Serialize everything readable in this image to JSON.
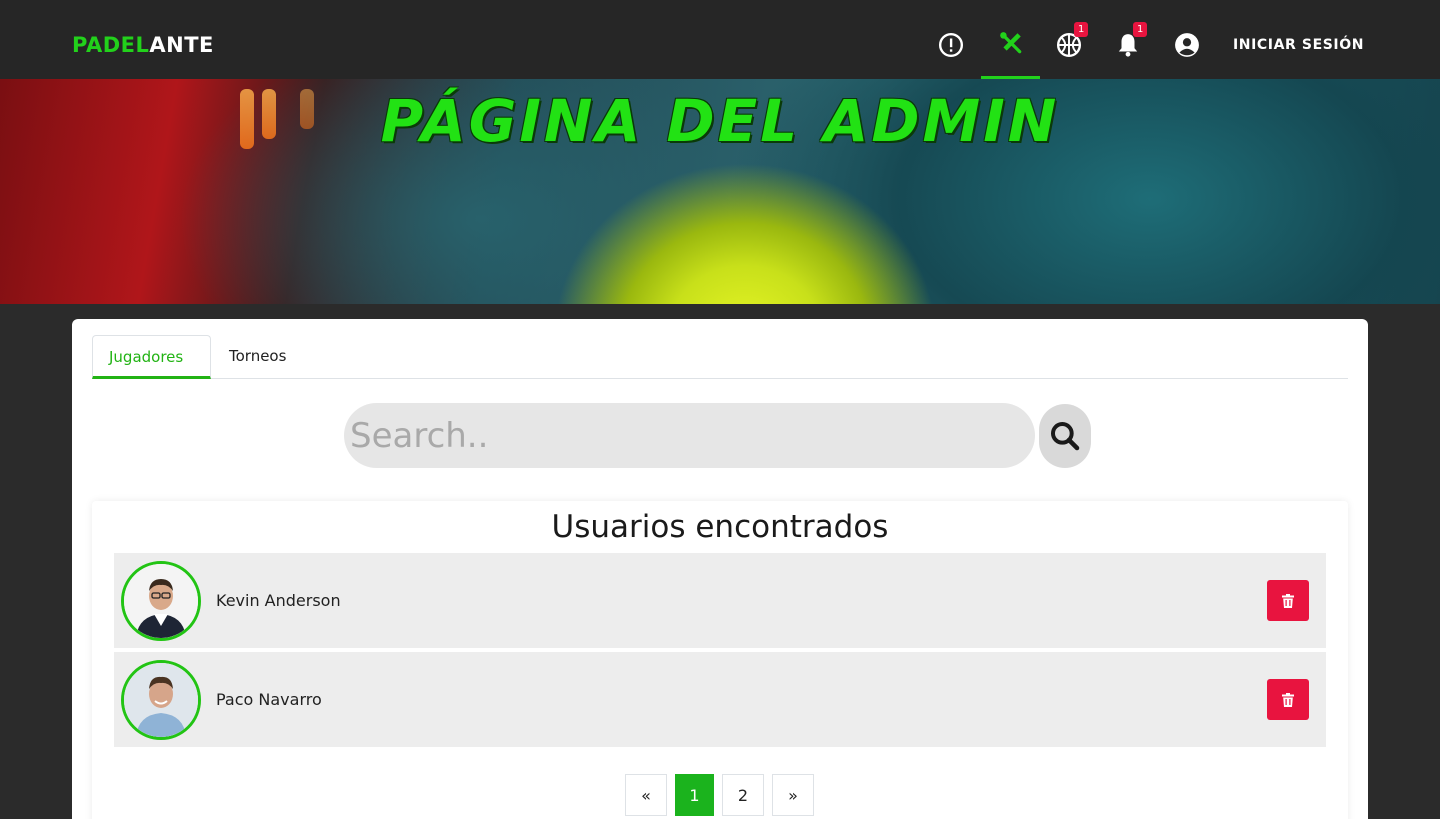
{
  "navbar": {
    "brand_part1": "PADEL",
    "brand_part2": "ANTE",
    "icons": [
      {
        "name": "alert-icon",
        "badge": ""
      },
      {
        "name": "tools-icon",
        "badge": "",
        "active": true
      },
      {
        "name": "basketball-icon",
        "badge": "1"
      },
      {
        "name": "bell-icon",
        "badge": "1"
      },
      {
        "name": "user-circle-icon",
        "badge": ""
      }
    ],
    "badge_tournaments": "1",
    "badge_notifications": "1",
    "login_label": "INICIAR SESIÓN"
  },
  "hero": {
    "title": "PÁGINA DEL ADMIN"
  },
  "tabs": [
    {
      "label": "Jugadores",
      "active": true
    },
    {
      "label": "Torneos",
      "active": false
    }
  ],
  "search": {
    "placeholder": "Search.."
  },
  "results": {
    "title": "Usuarios encontrados",
    "users": [
      {
        "name": "Kevin Anderson"
      },
      {
        "name": "Paco Navarro"
      }
    ]
  },
  "pagination": {
    "prev": "«",
    "pages": [
      "1",
      "2"
    ],
    "current": "1",
    "next": "»"
  },
  "colors": {
    "accent": "#22d11b",
    "danger": "#e8143f",
    "navbar": "#262626",
    "page_active": "#1bb31d"
  }
}
